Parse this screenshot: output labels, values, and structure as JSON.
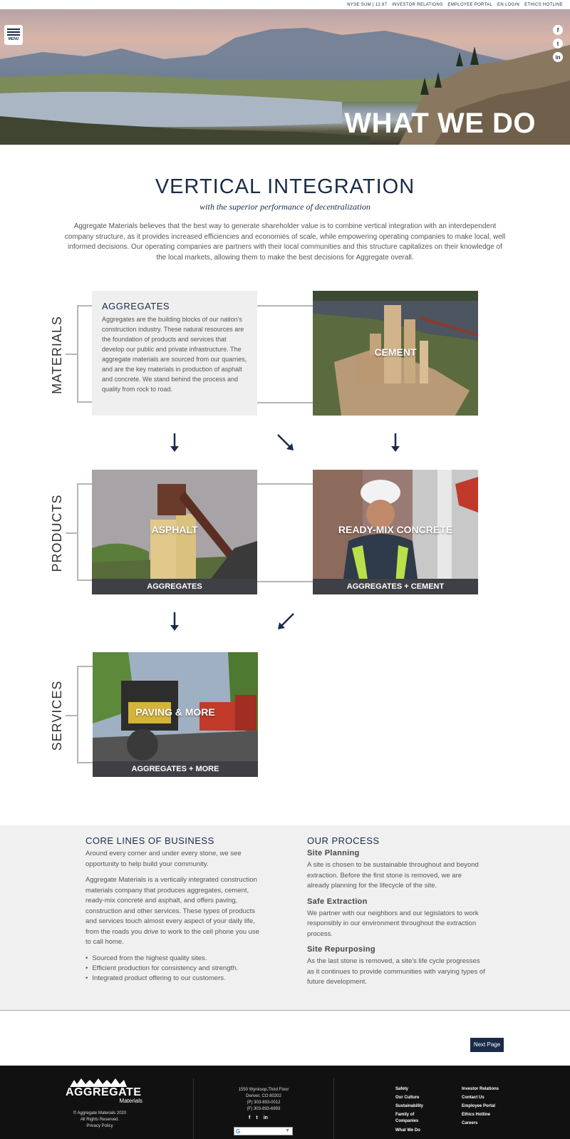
{
  "topbar": {
    "stock": "NYSE:SUM | 12.97",
    "investor_relations": "INVESTOR RELATIONS",
    "employee_portal": "EMPLOYEE PORTAL",
    "en_login": "EN LOGIN",
    "ethics_hotline": "ETHICS HOTLINE"
  },
  "hero": {
    "menu_label": "MENU",
    "title": "WHAT WE DO",
    "social_icons": [
      "facebook-icon",
      "twitter-icon",
      "linkedin-icon"
    ],
    "social_glyphs": {
      "facebook": "f",
      "twitter": "t",
      "linkedin": "in"
    }
  },
  "intro": {
    "title": "VERTICAL INTEGRATION",
    "subtitle": "with the superior performance of decentralization",
    "body": "Aggregate Materials believes that the best way to generate shareholder value is to combine vertical integration with an interdependent company structure, as it provides increased efficiencies and economies of scale, while empowering operating companies to make local, well informed decisions. Our operating companies are partners with their local communities and this structure capitalizes on their knowledge of the local markets, allowing them to make the best decisions for Aggregate overall."
  },
  "diagram": {
    "rows": {
      "materials": "MATERIALS",
      "products": "PRODUCTS",
      "services": "SERVICES"
    },
    "aggregates_card": {
      "title": "AGGREGATES",
      "body": "Aggregates are the building blocks of our nation's construction industry. These natural resources are the foundation of products and services that develop our public and private infrastructure. The aggregate materials are sourced from our quarries, and are the key materials in production of asphalt and concrete. We stand behind the process and quality from rock to road."
    },
    "cement": {
      "label": "CEMENT"
    },
    "asphalt": {
      "label": "ASPHALT",
      "footer": "AGGREGATES"
    },
    "concrete": {
      "label": "READY-MIX CONCRETE",
      "footer": "AGGREGATES + CEMENT"
    },
    "paving": {
      "label": "PAVING & MORE",
      "footer": "AGGREGATES + MORE"
    }
  },
  "business": {
    "title": "CORE LINES OF BUSINESS",
    "intro": "Around every corner and under every stone, we see opportunity to help build your community.",
    "body": "Aggregate Materials is a vertically integrated construction materials company that produces aggregates, cement, ready-mix concrete and asphalt, and offers paving, construction and other services. These types of products and services touch almost every aspect of your daily life, from the roads you drive to work to the cell phone you use to call home.",
    "bullets": [
      "Sourced from the highest quality sites.",
      "Efficient production for consistency and strength.",
      "Integrated product offering to our customers."
    ]
  },
  "process": {
    "title": "OUR PROCESS",
    "steps": [
      {
        "heading": "Site Planning",
        "text": "A site is chosen to be sustainable throughout and beyond extraction. Before the first stone is removed, we are already planning for the lifecycle of the site."
      },
      {
        "heading": "Safe Extraction",
        "text": "We partner with our neighbors and our legislators to work responsibly in our environment throughout the extraction process."
      },
      {
        "heading": "Site Repurposing",
        "text": "As the last stone is removed, a site's life cycle progresses as it continues to provide communities with varying types of future development."
      }
    ]
  },
  "next_page": "Next Page",
  "footer": {
    "logo_word": "AGGREGATE",
    "logo_sub": "Materials",
    "copyright": "© Aggregate Materials 2020",
    "rights": "All Rights Reserved.",
    "privacy": "Privacy Policy",
    "address1": "1550 Wynkoop,Third Floor",
    "address2": "Denver, CO 80202",
    "phone": "(P) 303-893-0012",
    "fax": "(F) 303-893-6993",
    "social_glyphs": [
      "f",
      "t",
      "in"
    ],
    "links_col1": [
      "Safety",
      "Our Culture",
      "Sustainability",
      "Family of Companies",
      "What We Do"
    ],
    "links_col2": [
      "Investor Relations",
      "Contact Us",
      "Employee Portal",
      "Ethics Hotline",
      "Careers"
    ]
  },
  "colors": {
    "navy": "#1a2b48",
    "footer_bg": "#111112",
    "band_bg": "#f0f0f0",
    "strip_bg": "#3f3f46"
  }
}
